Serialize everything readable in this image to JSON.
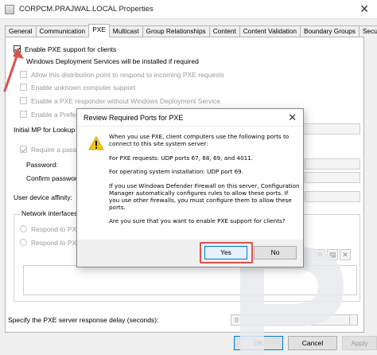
{
  "window": {
    "title": "CORPCM.PRAJWAL.LOCAL Properties",
    "close_glyph": "✕"
  },
  "tabs": [
    {
      "label": "General",
      "active": false
    },
    {
      "label": "Communication",
      "active": false
    },
    {
      "label": "PXE",
      "active": true
    },
    {
      "label": "Multicast",
      "active": false
    },
    {
      "label": "Group Relationships",
      "active": false
    },
    {
      "label": "Content",
      "active": false
    },
    {
      "label": "Content Validation",
      "active": false
    },
    {
      "label": "Boundary Groups",
      "active": false
    },
    {
      "label": "Security",
      "active": false
    }
  ],
  "pxe": {
    "enable_pxe": {
      "label": "Enable PXE support for clients",
      "checked": true
    },
    "wds_note": "Windows Deployment Services will be installed if required",
    "allow_distribution": "Allow this distribution point to respond to incoming PXE requests",
    "enable_unknown": "Enable unknown computer support",
    "enable_responder": "Enable a PXE responder without Windows Deployment Service",
    "enable_preferred": "Enable a Preferred",
    "initial_mp_label": "Initial MP for Lookup",
    "require_password": "Require a passw",
    "password_label": "Password:",
    "confirm_password_label": "Confirm password",
    "user_device_affinity_label": "User device affinity:",
    "network_interfaces_label": "Network interfaces",
    "respond_all": "Respond to PXE",
    "respond_specific": "Respond to PX",
    "response_delay_label": "Specify the PXE server response delay (seconds):",
    "response_delay_value": "0"
  },
  "footer": {
    "ok": "OK",
    "cancel": "Cancel",
    "apply": "Apply"
  },
  "dialog": {
    "title": "Review Required Ports for PXE",
    "close_glyph": "✕",
    "paragraphs": [
      "When you use PXE, client computers use the following ports to connect to this site system server:",
      "For PXE requests: UDP ports 67, 68, 69, and 4011.",
      "For operating system installation: UDP port 69.",
      "If you use Windows Defender Firewall on this server, Configuration Manager automatically configures rules to allow these ports. If you use other firewalls, you must configure them to allow these ports.",
      "Are you sure that you want to enable PXE support for clients?"
    ],
    "yes": "Yes",
    "no": "No"
  },
  "colors": {
    "annotation_red": "#d9534f",
    "accent_blue": "#0078d7",
    "warning_yellow": "#f7c800",
    "watermark_gray": "#e8eaee"
  }
}
